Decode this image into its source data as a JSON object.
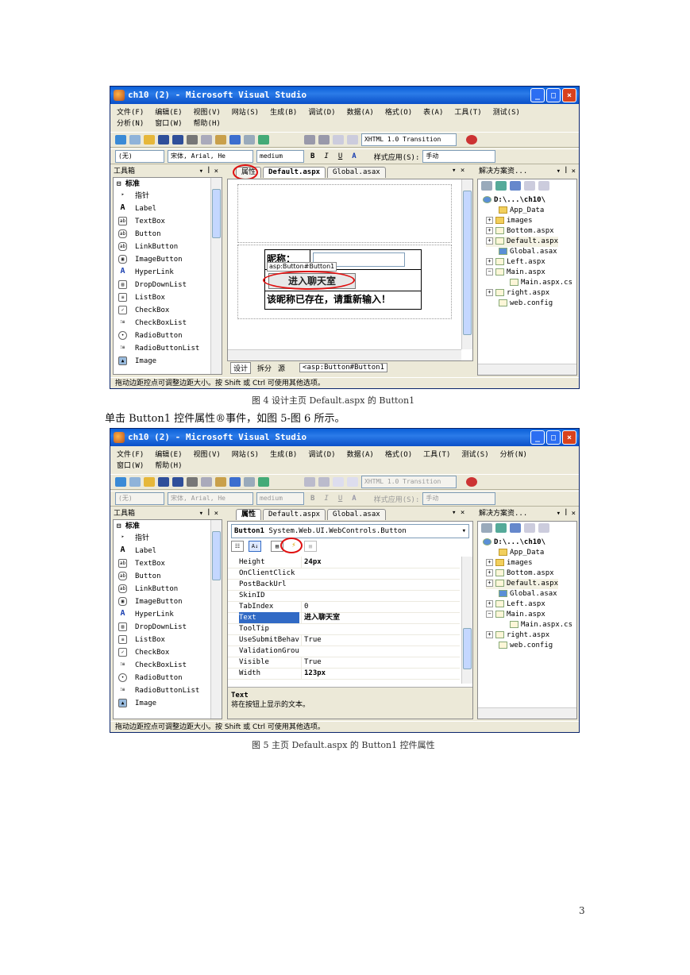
{
  "fig4": {
    "window_title": "ch10 (2) - Microsoft Visual Studio",
    "menu_row1": [
      "文件(F)",
      "编辑(E)",
      "视图(V)",
      "网站(S)",
      "生成(B)",
      "调试(D)",
      "数据(A)",
      "格式(O)",
      "表(A)",
      "工具(T)",
      "测试(S)"
    ],
    "menu_row2": [
      "分析(N)",
      "窗口(W)",
      "帮助(H)"
    ],
    "doctype_combo": "XHTML 1.0 Transition",
    "style_combo": "(无)",
    "font_combo": "宋体, Arial, He",
    "size_combo": "medium",
    "style_apply_label": "样式应用(S):",
    "style_apply_value": "手动",
    "toolbox_title": "工具箱",
    "toolbox_group": "标准",
    "toolbox_items": [
      "指针",
      "Label",
      "TextBox",
      "Button",
      "LinkButton",
      "ImageButton",
      "HyperLink",
      "DropDownList",
      "ListBox",
      "CheckBox",
      "CheckBoxList",
      "RadioButton",
      "RadioButtonList",
      "Image"
    ],
    "tabs": [
      "属性",
      "Default.aspx",
      "Global.asax"
    ],
    "design_nickname_label": "昵称：",
    "design_tag": "asp:Button#Button1",
    "design_button": "进入聊天室",
    "design_message": "该昵称已存在，请重新输入！",
    "bottom_tabs": [
      "设计",
      "拆分",
      "源"
    ],
    "bottom_path": "<asp:Button#Button1",
    "solution_title": "解决方案资...",
    "solution_root": "D:\\...\\ch10\\",
    "solution_items": [
      "App_Data",
      "images",
      "Bottom.aspx",
      "Default.aspx",
      "Global.asax",
      "Left.aspx",
      "Main.aspx",
      "Main.aspx.cs",
      "right.aspx",
      "web.config"
    ],
    "status": "拖动边距控点可调整边距大小。按 Shift 或 Ctrl 可使用其他选项。"
  },
  "caption4": "图 4   设计主页 Default.aspx 的 Button1",
  "body_line": "单击 Button1 控件属性®事件，如图 5-图 6 所示。",
  "fig5": {
    "window_title": "ch10 (2) - Microsoft Visual Studio",
    "menu_row1": [
      "文件(F)",
      "编辑(E)",
      "视图(V)",
      "网站(S)",
      "生成(B)",
      "调试(D)",
      "数据(A)",
      "格式(O)",
      "工具(T)",
      "测试(S)",
      "分析(N)"
    ],
    "menu_row2": [
      "窗口(W)",
      "帮助(H)"
    ],
    "doctype_combo": "XHTML 1.0 Transition",
    "style_combo": "(无)",
    "font_combo": "宋体, Arial, He",
    "size_combo": "medium",
    "style_apply_label": "样式应用(S):",
    "style_apply_value": "手动",
    "toolbox_title": "工具箱",
    "toolbox_group": "标准",
    "toolbox_items": [
      "指针",
      "Label",
      "TextBox",
      "Button",
      "LinkButton",
      "ImageButton",
      "HyperLink",
      "DropDownList",
      "ListBox",
      "CheckBox",
      "CheckBoxList",
      "RadioButton",
      "RadioButtonList",
      "Image"
    ],
    "tabs": [
      "属性",
      "Default.aspx",
      "Global.asax"
    ],
    "object_name": "Button1",
    "object_type": "System.Web.UI.WebControls.Button",
    "properties": [
      {
        "name": "Height",
        "value": "24px"
      },
      {
        "name": "OnClientClick",
        "value": ""
      },
      {
        "name": "PostBackUrl",
        "value": ""
      },
      {
        "name": "SkinID",
        "value": ""
      },
      {
        "name": "TabIndex",
        "value": "0"
      },
      {
        "name": "Text",
        "value": "进入聊天室"
      },
      {
        "name": "ToolTip",
        "value": ""
      },
      {
        "name": "UseSubmitBehav",
        "value": "True"
      },
      {
        "name": "ValidationGrou",
        "value": ""
      },
      {
        "name": "Visible",
        "value": "True"
      },
      {
        "name": "Width",
        "value": "123px"
      }
    ],
    "desc_title": "Text",
    "desc_text": "将在按钮上显示的文本。",
    "solution_title": "解决方案资...",
    "solution_root": "D:\\...\\ch10\\",
    "solution_items": [
      "App_Data",
      "images",
      "Bottom.aspx",
      "Default.aspx",
      "Global.asax",
      "Left.aspx",
      "Main.aspx",
      "Main.aspx.cs",
      "right.aspx",
      "web.config"
    ],
    "status": "拖动边距控点可调整边距大小。按 Shift 或 Ctrl 可使用其他选项。"
  },
  "caption5": "图 5   主页 Default.aspx 的 Button1 控件属性",
  "page_number": "3",
  "colors": {
    "title_blue": "#0A5FD8",
    "face": "#ECE9D8",
    "highlight": "#316AC5",
    "annotation_red": "#E01010"
  }
}
